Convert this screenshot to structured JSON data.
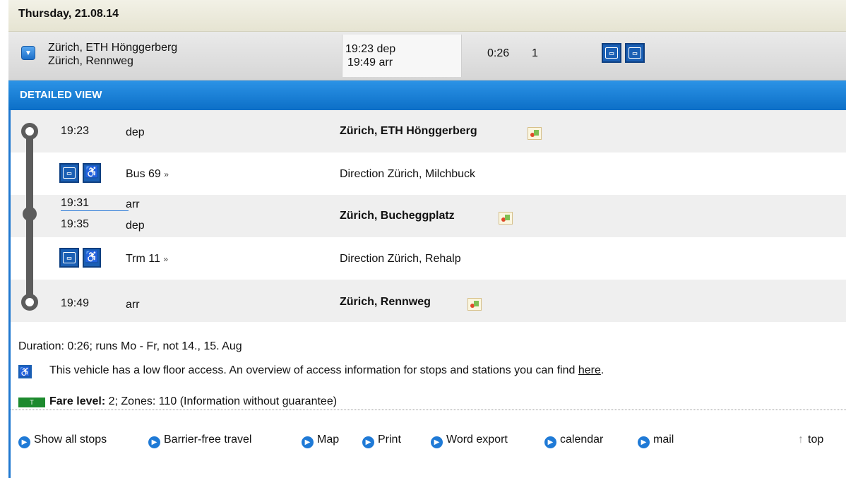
{
  "date_bar": {
    "label": "Thursday, 21.08.14"
  },
  "connection": {
    "expand_icon": "chevron-down-icon",
    "from": "Zürich, ETH Hönggerberg",
    "to": "Zürich, Rennweg",
    "dep": "19:23 dep",
    "arr": "19:49 arr",
    "duration": "0:26",
    "changes": "1"
  },
  "detail": {
    "header": "DETAILED VIEW",
    "stop1": {
      "time": "19:23",
      "kind": "dep",
      "name": "Zürich, ETH Hönggerberg"
    },
    "leg1": {
      "line": "Bus 69",
      "direction": "Direction Zürich, Milchbuck"
    },
    "stop2": {
      "arr_time": "19:31",
      "arr_kind": "arr",
      "dep_time": "19:35",
      "dep_kind": "dep",
      "name": "Zürich, Bucheggplatz"
    },
    "leg2": {
      "line": "Trm 11",
      "direction": "Direction Zürich, Rehalp"
    },
    "stop3": {
      "time": "19:49",
      "kind": "arr",
      "name": "Zürich, Rennweg"
    },
    "expand_glyph": "»"
  },
  "info": {
    "duration_text": "Duration: 0:26; runs Mo - Fr, not 14., 15. Aug",
    "access_text": "This vehicle has a low floor access. An overview of access information for stops and stations you can find ",
    "access_link": "here",
    "access_end": ".",
    "fare_badge": "T",
    "fare_label": "Fare level:",
    "fare_text": " 2; Zones: 110 (Information without guarantee)"
  },
  "links": {
    "show_all_stops": "Show all stops",
    "barrier_free": "Barrier-free travel",
    "map": "Map",
    "print": "Print",
    "word_export": "Word export",
    "calendar": "calendar",
    "mail": "mail",
    "top": "top"
  },
  "colors": {
    "accent": "#1f7ad6",
    "header": "#0c6fc7",
    "icon_blue": "#1a5fb4"
  }
}
